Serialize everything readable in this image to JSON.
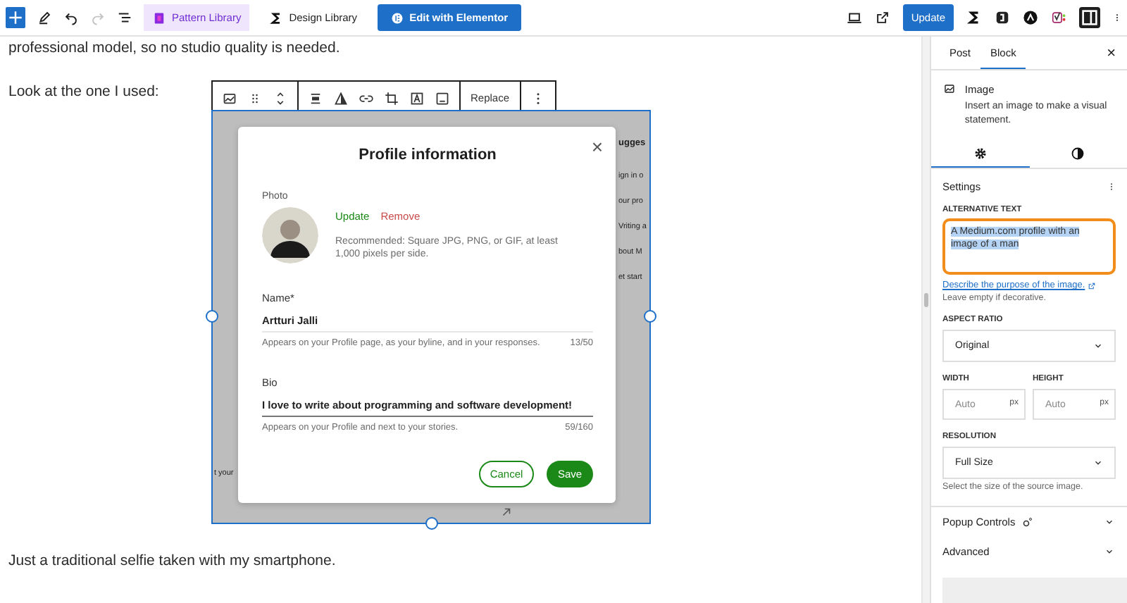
{
  "topbar": {
    "history": [
      {
        "kind": "undo",
        "disabled": false
      },
      {
        "kind": "redo",
        "disabled": true
      }
    ],
    "buttons": [
      {
        "kind": "pattern",
        "label": "Pattern Library"
      },
      {
        "kind": "design",
        "label": "Design Library"
      },
      {
        "kind": "elementor",
        "label": "Edit with Elementor"
      }
    ],
    "update": "Update",
    "sidebar_toggle": {
      "pressed": true
    }
  },
  "editor": {
    "paragraphs_before": [
      "professional model, so no studio quality is needed.",
      "Look at the one I used:"
    ],
    "block_toolbar": {
      "button": "Replace"
    },
    "image": {
      "background_texts": [
        {
          "kind": "heading",
          "text": "ugges"
        },
        {
          "kind": "line",
          "text": "ign in o"
        },
        {
          "kind": "line",
          "text": "our pro"
        },
        {
          "kind": "line",
          "text": "Vriting a"
        },
        {
          "kind": "line",
          "text": "bout M"
        },
        {
          "kind": "line",
          "text": "et start"
        }
      ],
      "left_text": "t your",
      "dialog": {
        "title": "Profile information",
        "close": "×",
        "photo_label": "Photo",
        "update": "Update",
        "remove": "Remove",
        "hint": "Recommended: Square JPG, PNG, or GIF, at least 1,000 pixels per side.",
        "fields": [
          {
            "label": "Name*",
            "value": "Artturi Jalli",
            "help": "Appears on your Profile page, as your byline, and in your responses.",
            "count": "13/50",
            "focused": false
          },
          {
            "label": "Bio",
            "value": "I love to write about programming and software development!",
            "help": "Appears on your Profile and next to your stories.",
            "count": "59/160",
            "focused": true
          }
        ],
        "cancel": "Cancel",
        "save": "Save"
      }
    },
    "paragraphs_after": [
      "Just a traditional selfie taken with my smartphone."
    ]
  },
  "sidebar": {
    "tabs": [
      {
        "label": "Post",
        "selected": false
      },
      {
        "label": "Block",
        "selected": true
      }
    ],
    "close": "×",
    "block": {
      "name": "Image",
      "description": "Insert an image to make a visual statement."
    },
    "panel_tabs": [
      {
        "kind": "settings",
        "selected": true
      },
      {
        "kind": "styles",
        "selected": false
      }
    ],
    "settings": {
      "title": "Settings",
      "alt_text": {
        "label": "ALTERNATIVE TEXT",
        "value": "A Medium.com profile with an image of a man",
        "text_selected": true,
        "annotated": true
      },
      "describe_link": "Describe the purpose of the image.",
      "describe_note": "Leave empty if decorative.",
      "aspect_ratio": {
        "label": "ASPECT RATIO",
        "value": "Original"
      },
      "width": {
        "label": "WIDTH",
        "placeholder": "Auto",
        "unit": "px"
      },
      "height": {
        "label": "HEIGHT",
        "placeholder": "Auto",
        "unit": "px"
      },
      "resolution": {
        "label": "RESOLUTION",
        "value": "Full Size",
        "help": "Select the size of the source image."
      }
    },
    "sections": [
      {
        "title": "Popup Controls",
        "expanded": false,
        "has_icon": true
      },
      {
        "title": "Advanced",
        "expanded": false,
        "has_icon": false
      }
    ]
  }
}
